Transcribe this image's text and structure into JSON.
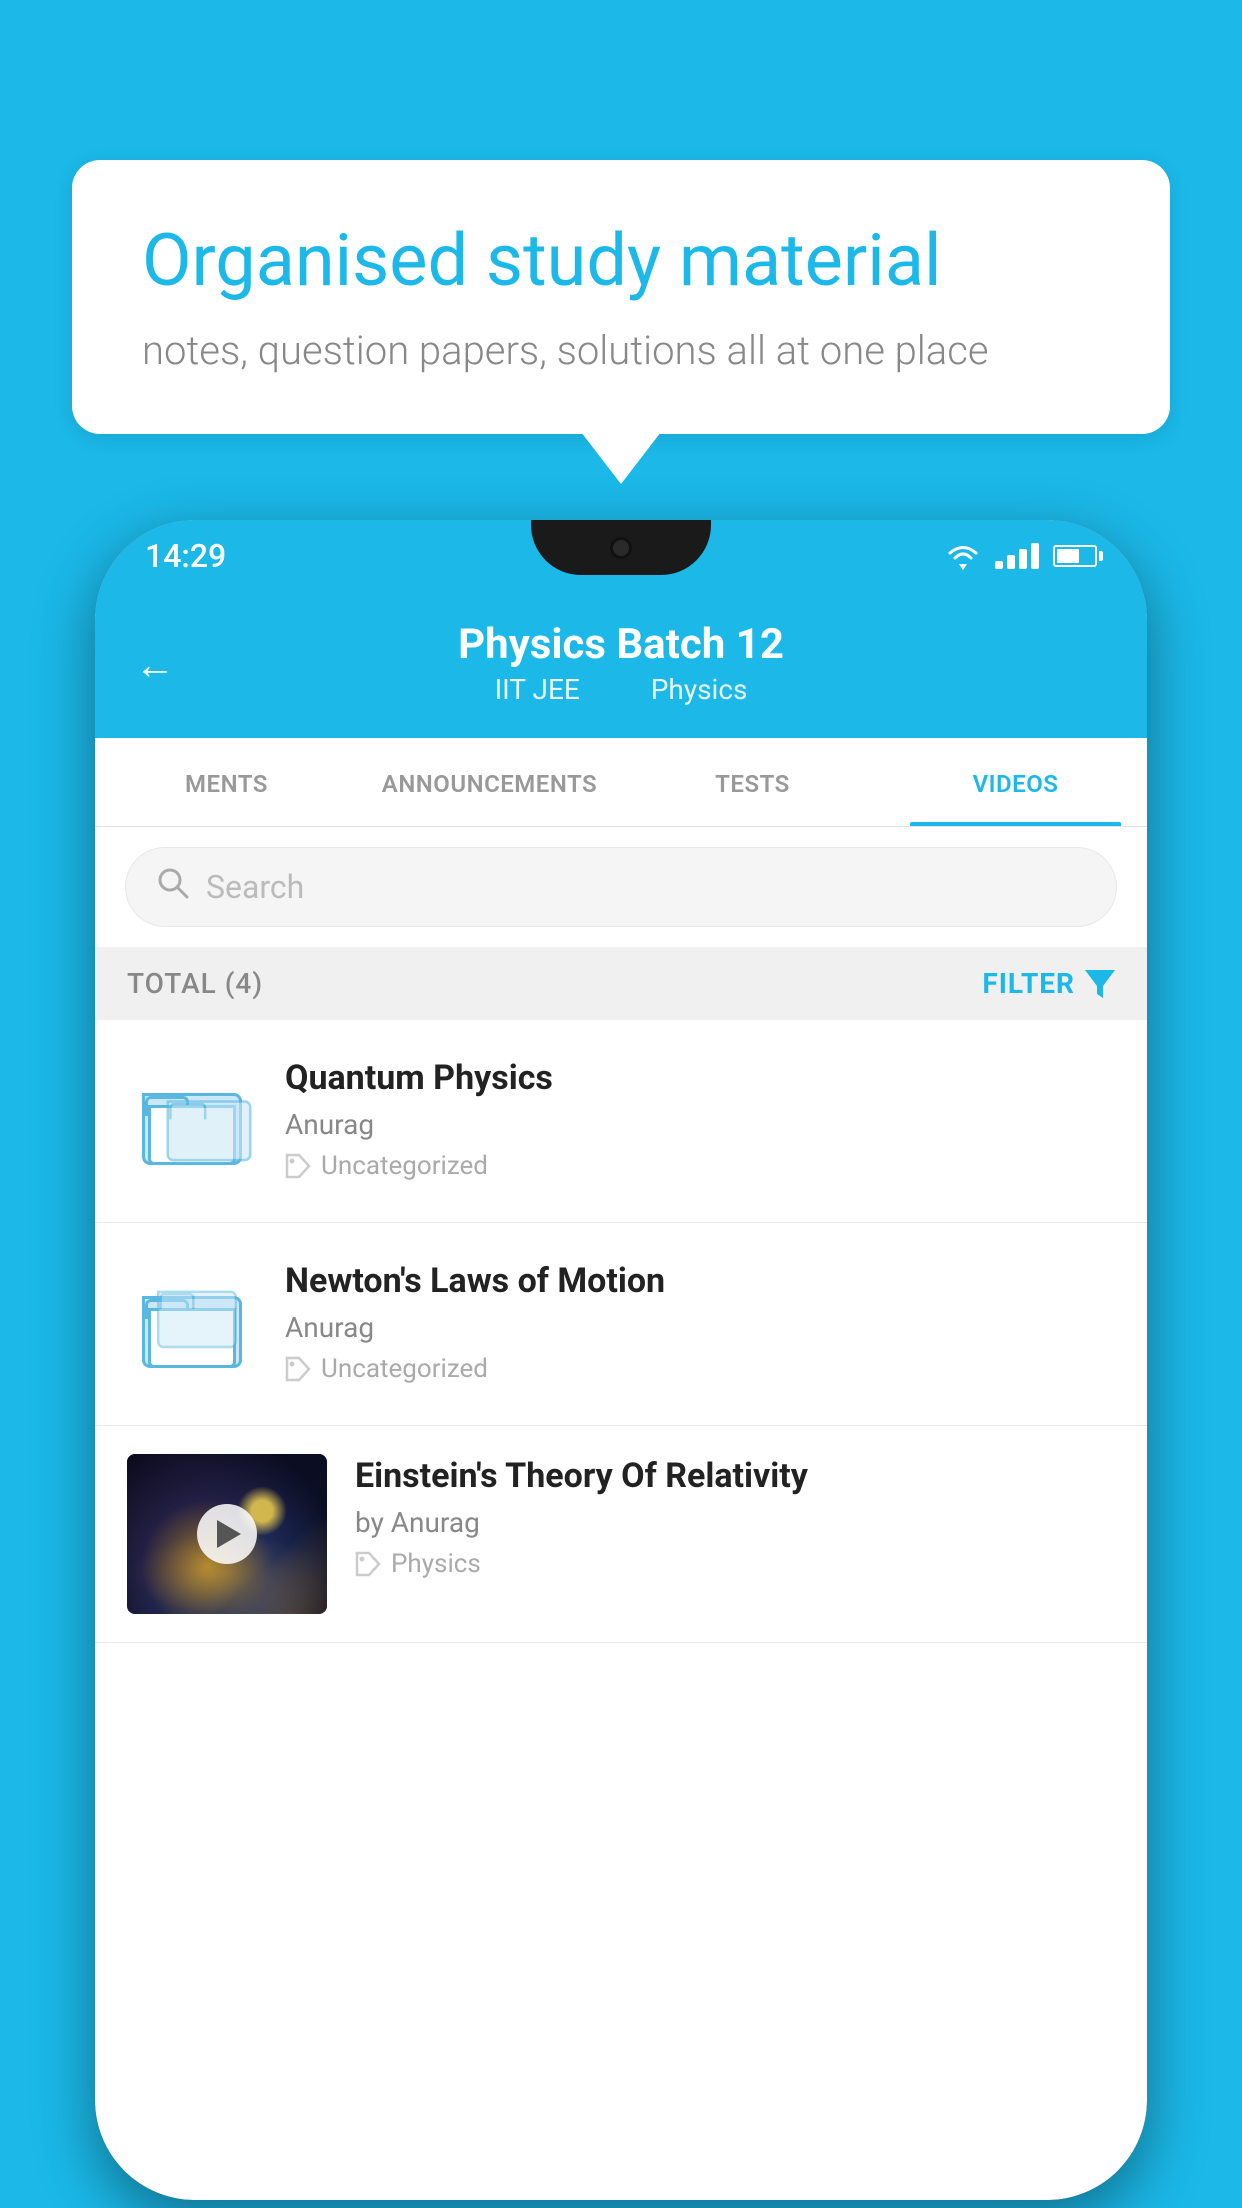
{
  "background_color": "#1bb8e8",
  "speech_bubble": {
    "title": "Organised study material",
    "subtitle": "notes, question papers, solutions all at one place"
  },
  "phone": {
    "status_bar": {
      "time": "14:29",
      "wifi": true,
      "signal": true,
      "battery": true
    },
    "header": {
      "back_label": "←",
      "title": "Physics Batch 12",
      "subtitle_part1": "IIT JEE",
      "subtitle_part2": "Physics"
    },
    "tabs": [
      {
        "label": "MENTS",
        "active": false
      },
      {
        "label": "ANNOUNCEMENTS",
        "active": false
      },
      {
        "label": "TESTS",
        "active": false
      },
      {
        "label": "VIDEOS",
        "active": true
      }
    ],
    "search": {
      "placeholder": "Search"
    },
    "filter_bar": {
      "total_label": "TOTAL (4)",
      "filter_label": "FILTER"
    },
    "videos": [
      {
        "id": 1,
        "title": "Quantum Physics",
        "author": "Anurag",
        "tag": "Uncategorized",
        "has_thumbnail": false
      },
      {
        "id": 2,
        "title": "Newton's Laws of Motion",
        "author": "Anurag",
        "tag": "Uncategorized",
        "has_thumbnail": false
      },
      {
        "id": 3,
        "title": "Einstein's Theory Of Relativity",
        "author": "by Anurag",
        "tag": "Physics",
        "has_thumbnail": true
      }
    ]
  }
}
